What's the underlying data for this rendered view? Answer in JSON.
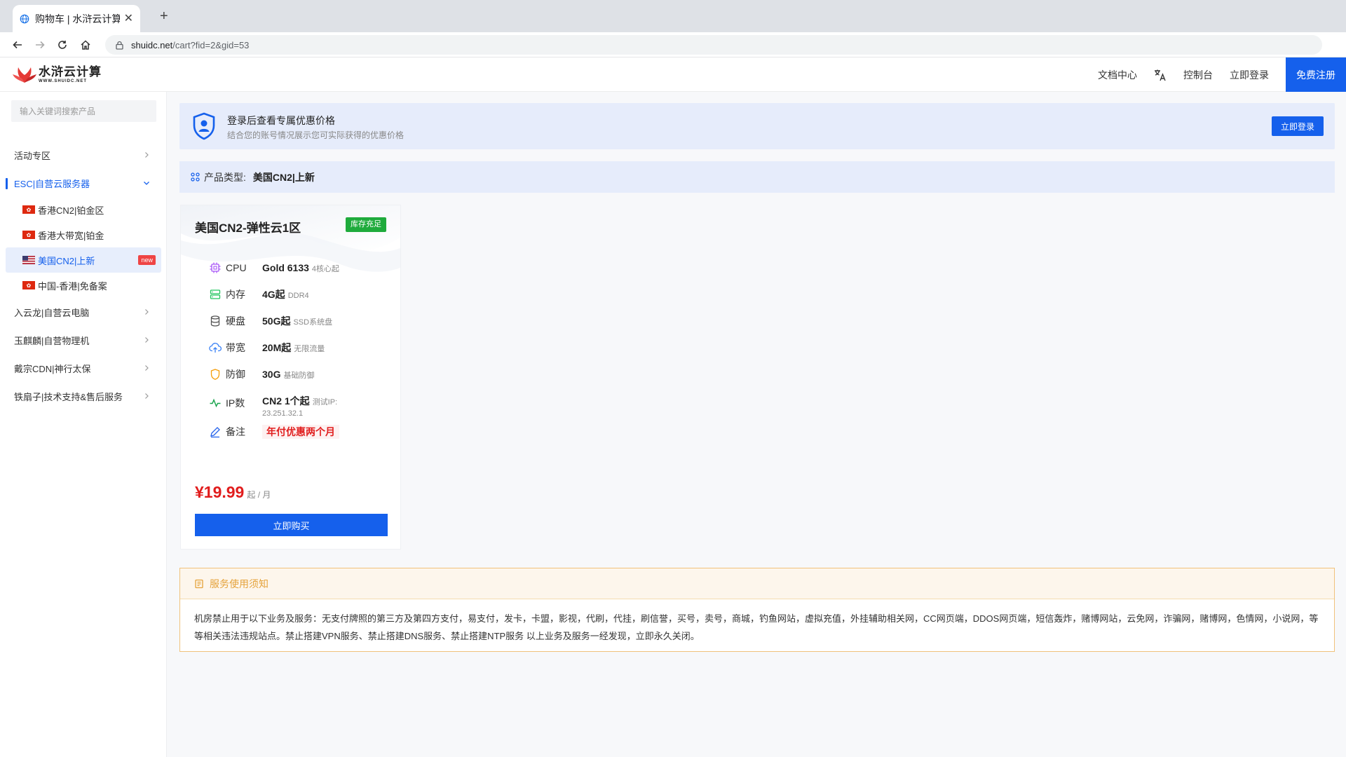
{
  "browser": {
    "tab_title": "购物车 | 水浒云计算",
    "tab_close": "✕",
    "new_tab": "+",
    "url_host": "shuidc.net",
    "url_path": "/cart?fid=2&gid=53"
  },
  "header": {
    "logo_cn": "水浒云计算",
    "logo_en": "WWW.SHUIDC.NET",
    "nav": {
      "docs": "文档中心",
      "console": "控制台",
      "login": "立即登录",
      "register": "免费注册"
    },
    "lang_icon": "translate-icon"
  },
  "sidebar": {
    "search_placeholder": "输入关键词搜索产品",
    "items": [
      {
        "label": "活动专区"
      },
      {
        "label": "ESC|自营云服务器"
      },
      {
        "label": "入云龙|自营云电脑"
      },
      {
        "label": "玉麒麟|自营物理机"
      },
      {
        "label": "戴宗CDN|神行太保"
      },
      {
        "label": "铁扇子|技术支持&售后服务"
      }
    ],
    "sub_items": [
      {
        "label": "香港CN2|铂金区"
      },
      {
        "label": "香港大带宽|铂金"
      },
      {
        "label": "美国CN2|上新",
        "badge": "new"
      },
      {
        "label": "中国-香港|免备案"
      }
    ]
  },
  "login_notice": {
    "title": "登录后查看专属优惠价格",
    "subtitle": "结合您的账号情况展示您可实际获得的优惠价格",
    "button": "立即登录"
  },
  "product_type": {
    "label": "产品类型:",
    "value": "美国CN2|上新"
  },
  "product": {
    "title": "美国CN2-弹性云1区",
    "stock": "库存充足",
    "specs": {
      "cpu": {
        "label": "CPU",
        "value": "Gold 6133",
        "sub": "4核心起"
      },
      "mem": {
        "label": "内存",
        "value": "4G起",
        "sub": "DDR4"
      },
      "disk": {
        "label": "硬盘",
        "value": "50G起",
        "sub": "SSD系统盘"
      },
      "bw": {
        "label": "带宽",
        "value": "20M起",
        "sub": "无限流量"
      },
      "ddos": {
        "label": "防御",
        "value": "30G",
        "sub": "基础防御"
      },
      "ip": {
        "label": "IP数",
        "value": "CN2 1个起",
        "sub": "测试IP:",
        "sub2": "23.251.32.1"
      },
      "remark": {
        "label": "备注",
        "value": "年付优惠两个月"
      }
    },
    "price": "¥19.99",
    "price_unit": "起 / 月",
    "buy": "立即购买"
  },
  "terms": {
    "title": "服务使用须知",
    "body": "机房禁止用于以下业务及服务：无支付牌照的第三方及第四方支付，易支付，发卡，卡盟，影视，代刷，代挂，刷信誉，买号，卖号，商城，钓鱼网站，虚拟充值，外挂辅助相关网，CC网页端，DDOS网页端，短信轰炸，赌博网站，云免网，诈骗网，赌博网，色情网，小说网，等等相关违法违规站点。禁止搭建VPN服务、禁止搭建DNS服务、禁止搭建NTP服务 以上业务及服务一经发现，立即永久关闭。"
  },
  "colors": {
    "primary": "#1560ec",
    "price_red": "#e11d1d",
    "stock_green": "#1fab3c",
    "notice_bg": "#e6ecfb",
    "warning_border": "#f0c27b"
  }
}
